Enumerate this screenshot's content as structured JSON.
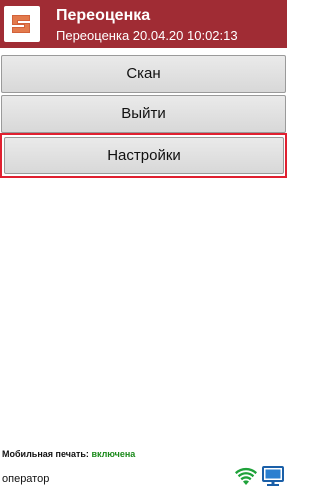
{
  "header": {
    "title": "Переоценка",
    "subtitle": "Переоценка 20.04.20 10:02:13",
    "logo_icon": "app-logo-icon",
    "color": "#a02c34"
  },
  "menu": {
    "scan_label": "Скан",
    "exit_label": "Выйти",
    "settings_label": "Настройки",
    "highlight_color": "#e02030"
  },
  "status": {
    "print_label": "Мобильная печать:",
    "print_value": "включена",
    "print_value_color": "#1a8a1a",
    "user": "оператор",
    "icons": [
      "wifi-icon",
      "monitor-icon"
    ]
  }
}
